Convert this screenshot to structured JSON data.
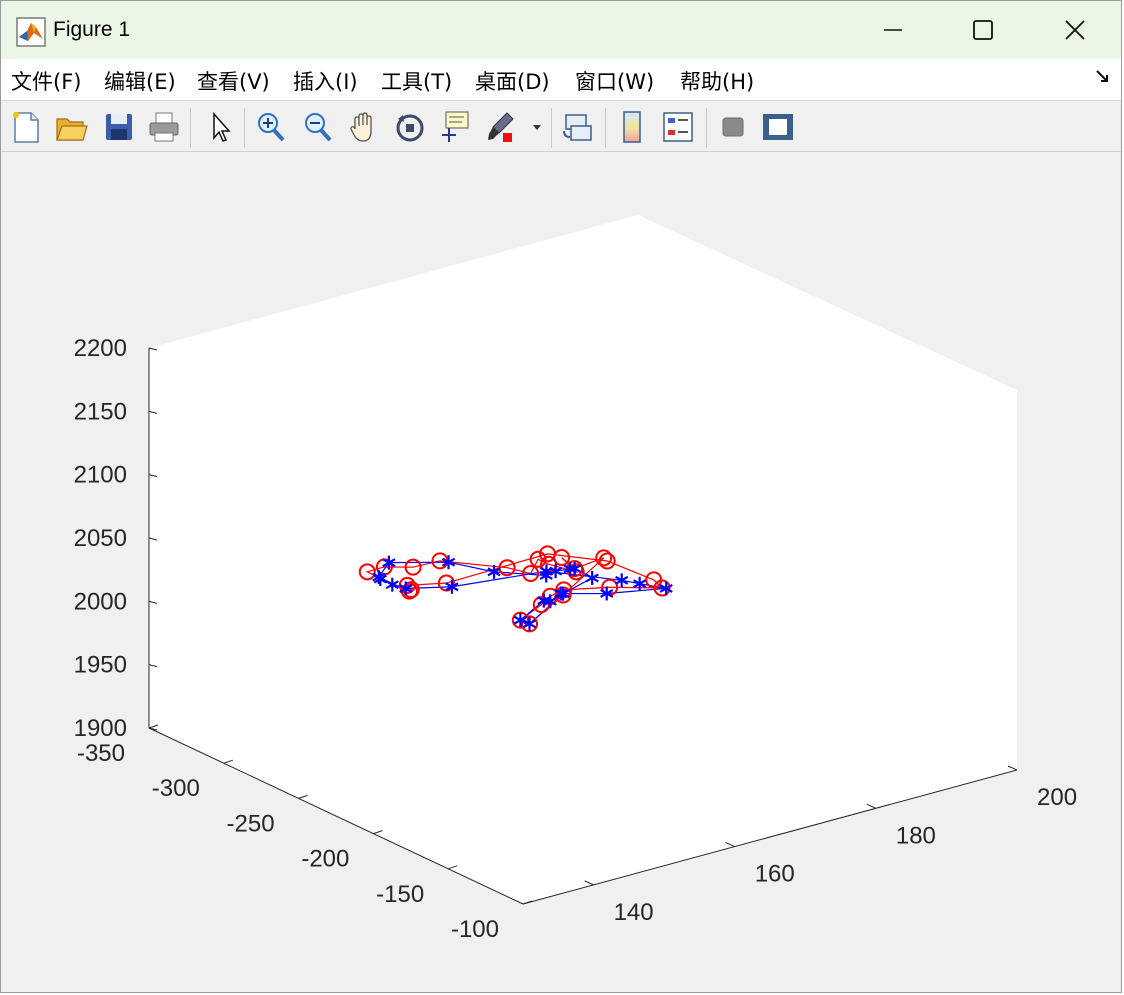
{
  "window": {
    "title": "Figure 1"
  },
  "menubar": {
    "items": [
      {
        "label": "文件(F)"
      },
      {
        "label": "编辑(E)"
      },
      {
        "label": "查看(V)"
      },
      {
        "label": "插入(I)"
      },
      {
        "label": "工具(T)"
      },
      {
        "label": "桌面(D)"
      },
      {
        "label": "窗口(W)"
      },
      {
        "label": "帮助(H)"
      }
    ],
    "dock_icon": "dock-arrow-icon"
  },
  "toolbar": {
    "buttons": [
      {
        "icon": "new-figure-icon"
      },
      {
        "icon": "open-file-icon"
      },
      {
        "icon": "save-icon"
      },
      {
        "icon": "print-icon"
      },
      {
        "icon": "pointer-icon"
      },
      {
        "icon": "zoom-in-icon"
      },
      {
        "icon": "zoom-out-icon"
      },
      {
        "icon": "pan-hand-icon"
      },
      {
        "icon": "rotate-3d-icon"
      },
      {
        "icon": "data-cursor-icon"
      },
      {
        "icon": "brush-icon"
      },
      {
        "icon": "link-plot-icon"
      },
      {
        "icon": "colorbar-icon"
      },
      {
        "icon": "legend-icon"
      },
      {
        "icon": "hide-plot-tools-icon"
      },
      {
        "icon": "show-plot-tools-icon"
      }
    ]
  },
  "colors": {
    "series_red": "#ff0000",
    "series_blue": "#0000ff",
    "titlebar": "#ecf6e6"
  },
  "chart_data": {
    "type": "scatter",
    "view": "3d",
    "title": "",
    "xlabel": "",
    "ylabel": "",
    "zlabel": "",
    "grid": false,
    "xlim": [
      130,
      200
    ],
    "ylim": [
      -350,
      -100
    ],
    "zlim": [
      1900,
      2200
    ],
    "x_ticks": [
      "140",
      "160",
      "180",
      "200"
    ],
    "y_ticks": [
      "-100",
      "-150",
      "-200",
      "-250",
      "-300",
      "-350"
    ],
    "z_ticks": [
      "1900",
      "1950",
      "2000",
      "2050",
      "2100",
      "2150",
      "2200"
    ],
    "series": [
      {
        "marker": "o",
        "color": "#ff0000",
        "points": [
          [
            161,
            -248,
            1995
          ],
          [
            161,
            -234,
            2015
          ],
          [
            161,
            -228,
            2025
          ],
          [
            161,
            -219,
            2035
          ],
          [
            162,
            -193,
            2050
          ],
          [
            169,
            -191,
            2040
          ],
          [
            171,
            -206,
            2035
          ],
          [
            168,
            -223,
            2045
          ],
          [
            164,
            -244,
            2045
          ],
          [
            152,
            -255,
            2034
          ],
          [
            149,
            -267,
            2030
          ],
          [
            150,
            -269,
            2024
          ],
          [
            151,
            -275,
            2018
          ],
          [
            148,
            -289,
            2030
          ],
          [
            150,
            -287,
            2032
          ],
          [
            153,
            -282,
            2030
          ],
          [
            153,
            -264,
            2045
          ],
          [
            157,
            -238,
            2048
          ],
          [
            158,
            -227,
            2048
          ],
          [
            158,
            -222,
            2062
          ],
          [
            158,
            -215,
            2062
          ],
          [
            160,
            -206,
            2058
          ],
          [
            159,
            -211,
            2068
          ],
          [
            160,
            -207,
            2060
          ],
          [
            162,
            -197,
            2071
          ],
          [
            159,
            -210,
            2039
          ],
          [
            157,
            -223,
            2012
          ]
        ]
      },
      {
        "marker": "*",
        "color": "#0000ff",
        "points": [
          [
            161,
            -248,
            1995
          ],
          [
            162,
            -237,
            2015
          ],
          [
            161,
            -228,
            2021
          ],
          [
            161,
            -221,
            2031
          ],
          [
            162,
            -195,
            2044
          ],
          [
            170,
            -193,
            2037
          ],
          [
            169,
            -206,
            2035
          ],
          [
            169,
            -218,
            2031
          ],
          [
            163,
            -240,
            2035
          ],
          [
            153,
            -256,
            2029
          ],
          [
            149,
            -268,
            2027
          ],
          [
            149,
            -277,
            2025
          ],
          [
            149,
            -285,
            2025
          ],
          [
            149,
            -286,
            2026
          ],
          [
            150,
            -284,
            2037
          ],
          [
            154,
            -263,
            2043
          ],
          [
            156,
            -242,
            2044
          ],
          [
            160,
            -226,
            2044
          ],
          [
            159,
            -215,
            2055
          ],
          [
            160,
            -210,
            2058
          ],
          [
            160,
            -207,
            2060
          ],
          [
            161,
            -200,
            2055
          ],
          [
            159,
            -210,
            2040
          ],
          [
            157,
            -223,
            2012
          ]
        ]
      }
    ]
  }
}
